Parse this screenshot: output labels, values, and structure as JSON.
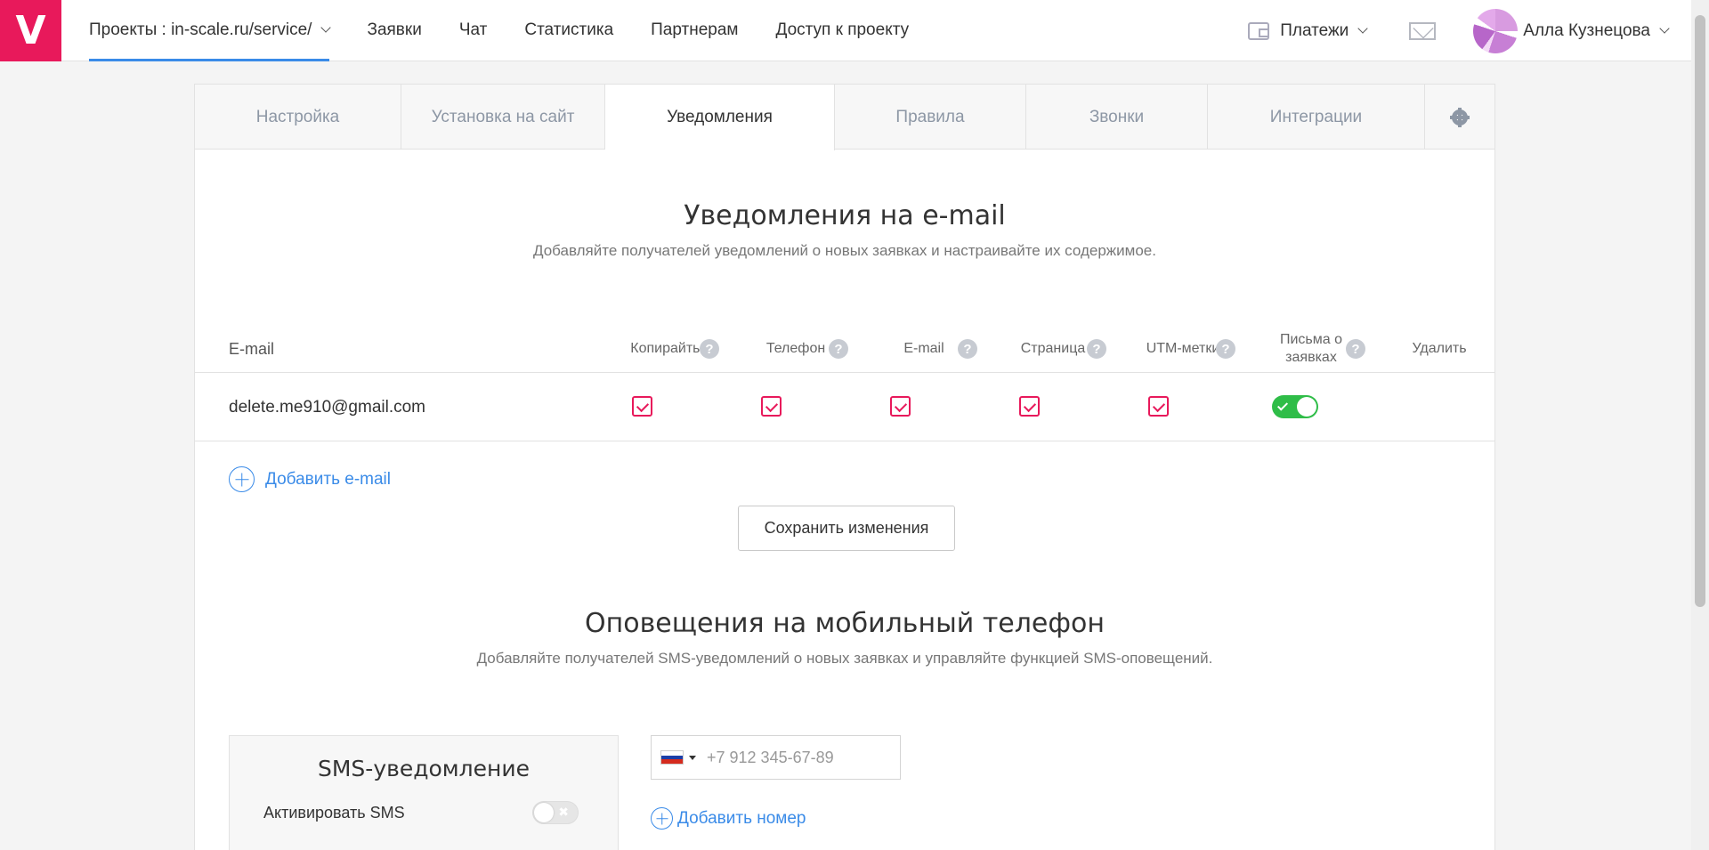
{
  "header": {
    "logo": "V",
    "nav": [
      {
        "label": "Проекты : in-scale.ru/service/",
        "active": true,
        "dropdown": true
      },
      {
        "label": "Заявки"
      },
      {
        "label": "Чат"
      },
      {
        "label": "Статистика"
      },
      {
        "label": "Партнерам"
      },
      {
        "label": "Доступ к проекту"
      }
    ],
    "payments_label": "Платежи",
    "user_name": "Алла Кузнецова"
  },
  "tabs": [
    {
      "label": "Настройка"
    },
    {
      "label": "Установка на сайт"
    },
    {
      "label": "Уведомления",
      "active": true
    },
    {
      "label": "Правила"
    },
    {
      "label": "Звонки"
    },
    {
      "label": "Интеграции"
    }
  ],
  "email_section": {
    "title": "Уведомления на e-mail",
    "subtitle": "Добавляйте получателей уведомлений о новых заявках и настраивайте их содержимое.",
    "columns": {
      "email": "E-mail",
      "copywrites": "Копирайты",
      "phone": "Телефон",
      "email_col": "E-mail",
      "page": "Страница",
      "utm": "UTM-метки",
      "letters": "Письма о заявках",
      "delete": "Удалить"
    },
    "help_glyph": "?",
    "rows": [
      {
        "email": "delete.me910@gmail.com",
        "copywrites": true,
        "phone": true,
        "email_col": true,
        "page": true,
        "utm": true,
        "letters": true
      }
    ],
    "add_email": "Добавить e-mail",
    "save_button": "Сохранить изменения"
  },
  "mobile_section": {
    "title": "Оповещения на мобильный телефон",
    "subtitle": "Добавляйте получателей SMS-уведомлений о новых заявках и управляйте функцией SMS-оповещений.",
    "sms_box_title": "SMS-уведомление",
    "activate_sms": "Активировать SMS",
    "sms_active": false,
    "phone_placeholder": "+7 912 345-67-89",
    "add_number": "Добавить номер"
  },
  "colors": {
    "brand": "#e8195b",
    "link": "#3a8be8",
    "toggle_on": "#2fbd48"
  }
}
